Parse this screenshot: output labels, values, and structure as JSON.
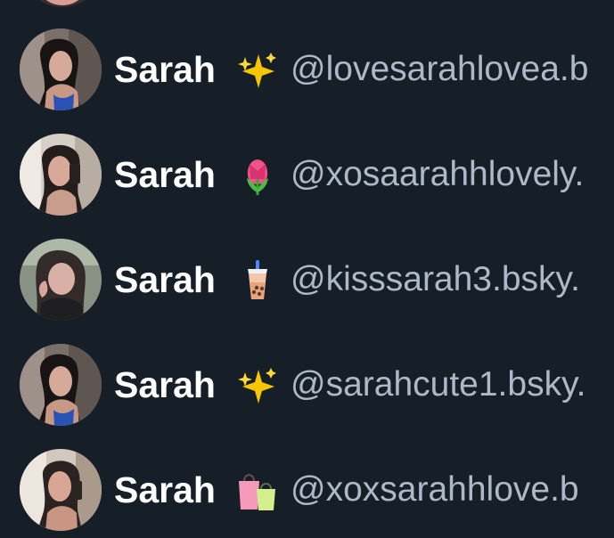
{
  "colors": {
    "background": "#161e27",
    "name": "#ffffff",
    "handle": "#aeb9c8"
  },
  "rows": [
    {
      "name": "Sarah",
      "emoji": "sparkles-icon",
      "handle": "@lovesarahlovea.b"
    },
    {
      "name": "Sarah",
      "emoji": "tulip-icon",
      "handle": "@xosaarahhlovely."
    },
    {
      "name": "Sarah",
      "emoji": "bubble-tea-icon",
      "handle": "@kisssarah3.bsky."
    },
    {
      "name": "Sarah",
      "emoji": "sparkles-icon",
      "handle": "@sarahcute1.bsky."
    },
    {
      "name": "Sarah",
      "emoji": "shopping-bags-icon",
      "handle": "@xoxsarahhlove.b"
    }
  ]
}
